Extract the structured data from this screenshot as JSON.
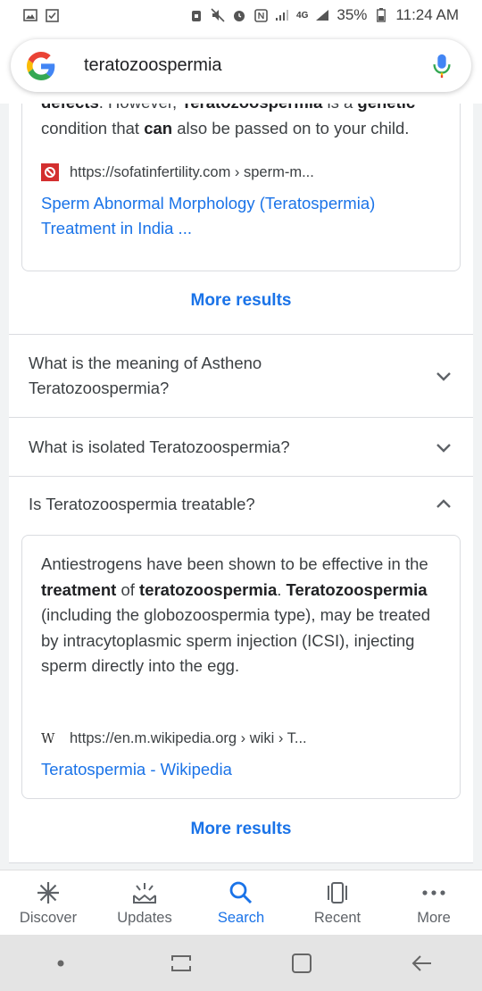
{
  "status_bar": {
    "battery_percent": "35%",
    "time": "11:24 AM",
    "network": "4G"
  },
  "search": {
    "query": "teratozoospermia"
  },
  "result_card_1": {
    "snippet_parts": [
      {
        "text": "defects",
        "bold": true
      },
      {
        "text": ". However, ",
        "bold": false
      },
      {
        "text": "Teratozoospermia",
        "bold": true
      },
      {
        "text": " is a ",
        "bold": false
      },
      {
        "text": "genetic",
        "bold": true
      },
      {
        "text": " condition that ",
        "bold": false
      },
      {
        "text": "can",
        "bold": true
      },
      {
        "text": " also be passed on to your child.",
        "bold": false
      }
    ],
    "source_url": "https://sofatinfertility.com › sperm-m...",
    "link_title": "Sperm Abnormal Morphology (Teratospermia) Treatment in India ..."
  },
  "more_results_1": "More results",
  "faq": [
    {
      "question": "What is the meaning of Astheno Teratozoospermia?",
      "expanded": false
    },
    {
      "question": "What is isolated Teratozoospermia?",
      "expanded": false
    },
    {
      "question": "Is Teratozoospermia treatable?",
      "expanded": true
    }
  ],
  "result_card_2": {
    "snippet_parts": [
      {
        "text": "Antiestrogens have been shown to be effective in the ",
        "bold": false
      },
      {
        "text": "treatment",
        "bold": true
      },
      {
        "text": " of ",
        "bold": false
      },
      {
        "text": "teratozoospermia",
        "bold": true
      },
      {
        "text": ". ",
        "bold": false
      },
      {
        "text": "Teratozoospermia",
        "bold": true
      },
      {
        "text": " (including the globozoospermia type), may be treated by intracytoplasmic sperm injection (ICSI), injecting sperm directly into the egg.",
        "bold": false
      }
    ],
    "source_url": "https://en.m.wikipedia.org › wiki › T...",
    "link_title": "Teratospermia - Wikipedia"
  },
  "more_results_2": "More results",
  "bottom_nav": {
    "items": [
      {
        "label": "Discover",
        "icon": "asterisk-icon",
        "active": false
      },
      {
        "label": "Updates",
        "icon": "updates-icon",
        "active": false
      },
      {
        "label": "Search",
        "icon": "search-icon",
        "active": true
      },
      {
        "label": "Recent",
        "icon": "recent-icon",
        "active": false
      },
      {
        "label": "More",
        "icon": "more-dots-icon",
        "active": false
      }
    ]
  },
  "colors": {
    "link_blue": "#1a73e8",
    "text": "#3c4043",
    "divider": "#dadce0"
  }
}
